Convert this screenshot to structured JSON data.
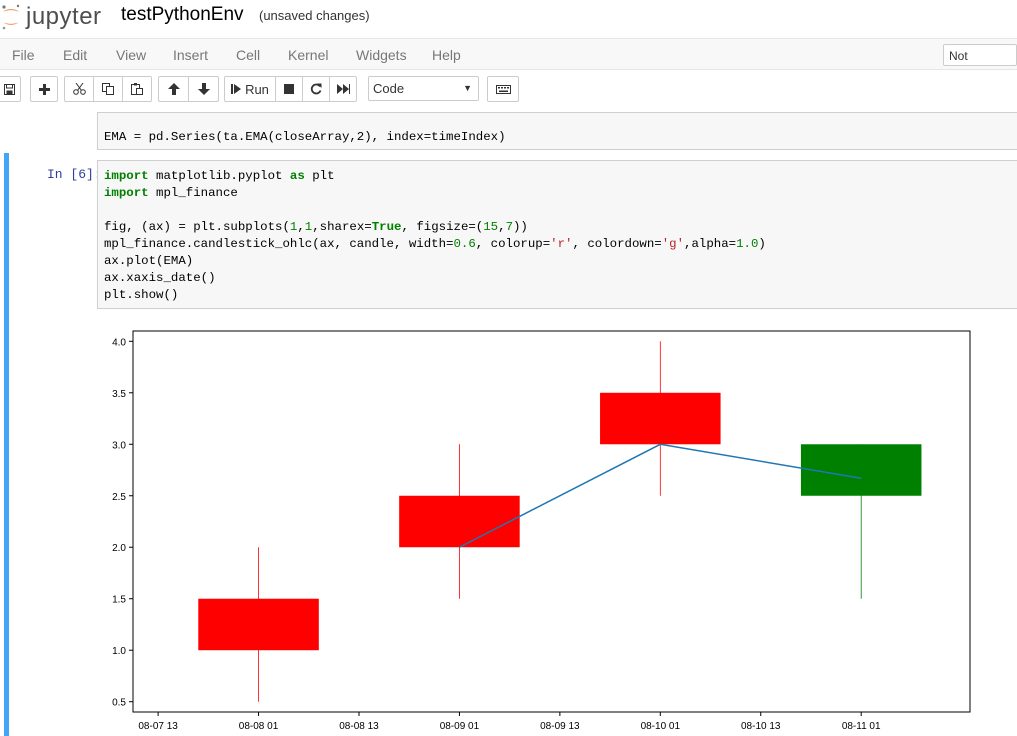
{
  "header": {
    "logo_text": "jupyter",
    "notebook_name": "testPythonEnv",
    "save_status": "(unsaved changes)"
  },
  "menubar": {
    "items": [
      "File",
      "Edit",
      "View",
      "Insert",
      "Cell",
      "Kernel",
      "Widgets",
      "Help"
    ],
    "trust_label": "Not Trusted"
  },
  "toolbar": {
    "icons": [
      "save-icon",
      "plus-icon",
      "cut-icon",
      "copy-icon",
      "paste-icon",
      "arrow-up-icon",
      "arrow-down-icon",
      "step-forward-icon",
      "stop-icon",
      "restart-icon",
      "fast-forward-icon",
      "keyboard-icon"
    ],
    "run_label": "Run",
    "cell_type": "Code"
  },
  "prev_cell": {
    "code_line": "EMA = pd.Series(ta.EMA(closeArray,2), index=timeIndex)"
  },
  "cell": {
    "prompt": "In [6]:",
    "code": [
      "import matplotlib.pyplot as plt",
      "import mpl_finance",
      "",
      "fig, (ax) = plt.subplots(1,1,sharex=True, figsize=(15,7))",
      "mpl_finance.candlestick_ohlc(ax, candle, width=0.6, colorup='r', colordown='g',alpha=1.0)",
      "ax.plot(EMA)",
      "ax.xaxis_date()",
      "plt.show()"
    ],
    "accent_color": "#42a5f5"
  },
  "chart_data": {
    "type": "candlestick",
    "title": "",
    "xlabel": "",
    "ylabel": "",
    "ylim": [
      0.4,
      4.1
    ],
    "xlim": [
      "08-07 10",
      "08-11 14"
    ],
    "x_ticks": [
      "08-07 13",
      "08-08 01",
      "08-08 13",
      "08-09 01",
      "08-09 13",
      "08-10 01",
      "08-10 13",
      "08-11 01"
    ],
    "y_ticks": [
      "0.5",
      "1.0",
      "1.5",
      "2.0",
      "2.5",
      "3.0",
      "3.5",
      "4.0"
    ],
    "candles": [
      {
        "date": "08-08 01",
        "open": 1.0,
        "high": 2.0,
        "low": 0.5,
        "close": 1.5,
        "color": "#ff0000"
      },
      {
        "date": "08-09 01",
        "open": 2.0,
        "high": 3.0,
        "low": 1.5,
        "close": 2.5,
        "color": "#ff0000"
      },
      {
        "date": "08-10 01",
        "open": 3.0,
        "high": 4.0,
        "low": 2.5,
        "close": 3.5,
        "color": "#ff0000"
      },
      {
        "date": "08-11 01",
        "open": 3.0,
        "high": 3.0,
        "low": 1.5,
        "close": 2.5,
        "color": "#008000"
      }
    ],
    "candle_width_days": 0.6,
    "series": [
      {
        "x": [
          "08-09 01",
          "08-10 01",
          "08-11 01"
        ],
        "values": [
          2.0,
          3.0,
          2.67
        ],
        "color": "#1f77b4"
      }
    ],
    "grid": false
  }
}
